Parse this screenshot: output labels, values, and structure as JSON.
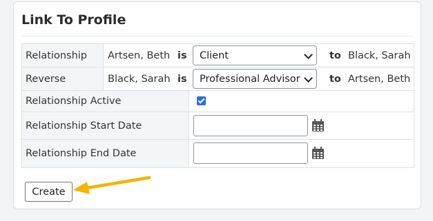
{
  "panel": {
    "title": "Link To Profile"
  },
  "relationship_row": {
    "label": "Relationship",
    "from_name": "Artsen, Beth",
    "is_word": "is",
    "selected_value": "Client",
    "to_word": "to",
    "to_name": "Black, Sarah"
  },
  "reverse_row": {
    "label": "Reverse",
    "from_name": "Black, Sarah",
    "is_word": "is",
    "selected_value": "Professional Advisor",
    "to_word": "to",
    "to_name": "Artsen, Beth"
  },
  "active_row": {
    "label": "Relationship Active",
    "checked": true
  },
  "start_row": {
    "label": "Relationship Start Date",
    "value": ""
  },
  "end_row": {
    "label": "Relationship End Date",
    "value": ""
  },
  "actions": {
    "create_label": "Create"
  },
  "colors": {
    "arrow": "#f4b400",
    "checkbox": "#2d6cdf"
  },
  "icons": [
    "calendar-icon",
    "chevron-down-icon",
    "arrow-pointer-icon"
  ]
}
